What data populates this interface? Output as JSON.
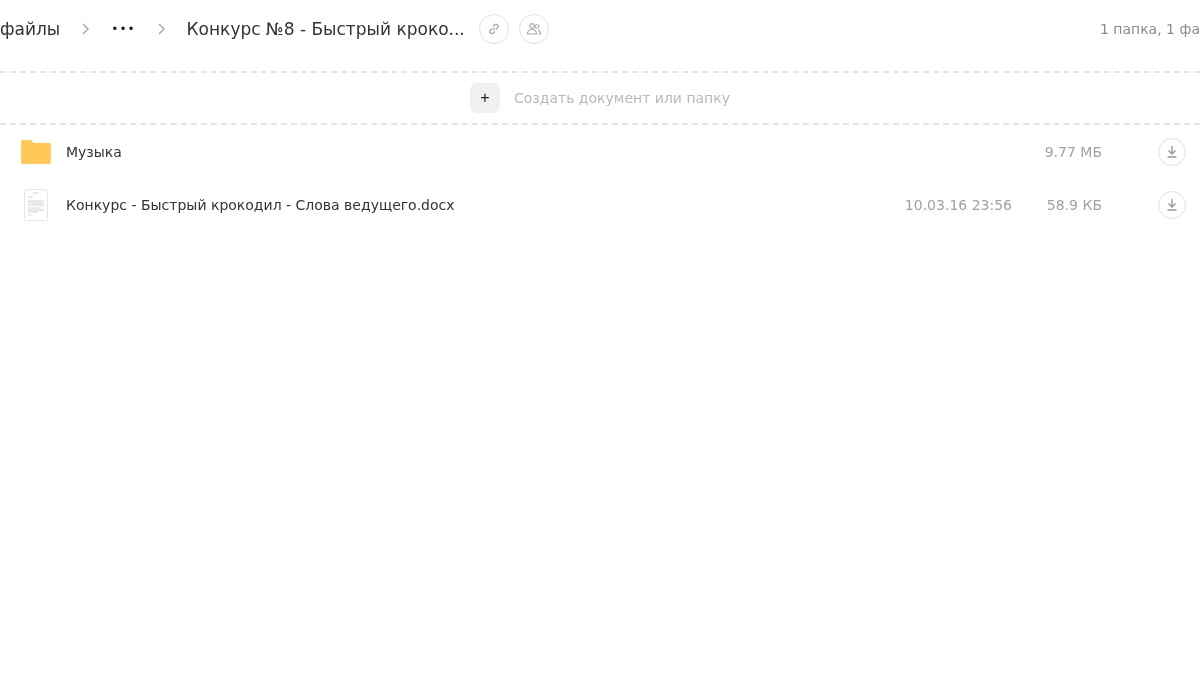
{
  "breadcrumbs": [
    {
      "label": "файлы",
      "kind": "link"
    },
    {
      "label": "•••",
      "kind": "more"
    },
    {
      "label": "Конкурс №8 - Быстрый кроко...",
      "kind": "current"
    }
  ],
  "summary": "1 папка, 1 фа",
  "create": {
    "icon": "+",
    "label": "Создать документ или папку"
  },
  "items": [
    {
      "kind": "folder",
      "name": "Музыка",
      "size": "9.77 МБ"
    },
    {
      "kind": "document",
      "name": "Конкурс - Быстрый крокодил - Слова ведущего.docx",
      "date": "10.03.16 23:56",
      "size": "58.9 КБ"
    }
  ]
}
